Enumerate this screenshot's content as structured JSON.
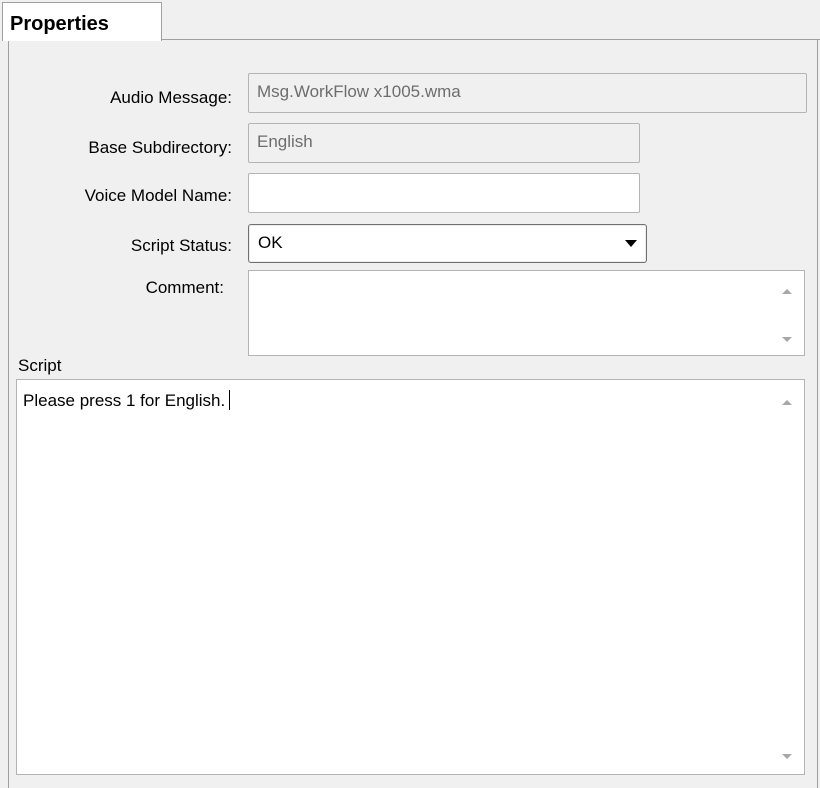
{
  "tab": {
    "label": "Properties"
  },
  "fields": {
    "audio_message": {
      "label": "Audio Message:",
      "value": "Msg.WorkFlow x1005.wma"
    },
    "base_subdirectory": {
      "label": "Base Subdirectory:",
      "value": "English"
    },
    "voice_model_name": {
      "label": "Voice Model Name:",
      "value": ""
    },
    "script_status": {
      "label": "Script Status:",
      "value": "OK"
    },
    "comment": {
      "label": "Comment:",
      "value": ""
    }
  },
  "script": {
    "label": "Script",
    "value": "Please press 1 for English."
  },
  "icons": {
    "dropdown": "chevron-down-icon",
    "scroll_up": "scroll-up-arrow-icon",
    "scroll_down": "scroll-down-arrow-icon"
  },
  "colors": {
    "panel_bg": "#f0f0f0",
    "border": "#a0a0a0",
    "readonly_text": "#6d6d6d"
  }
}
